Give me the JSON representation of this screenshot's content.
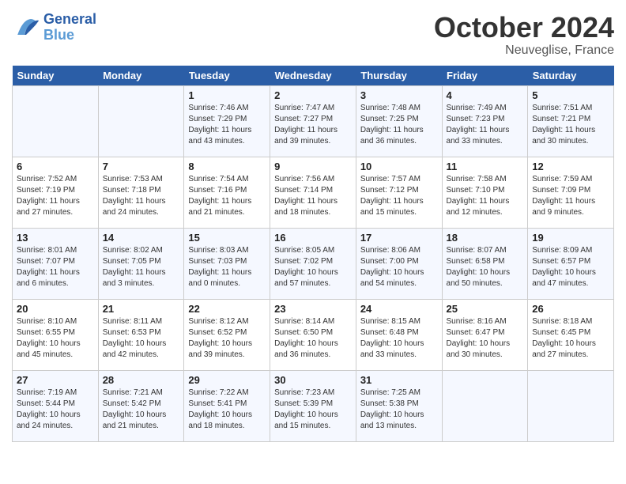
{
  "header": {
    "logo_general": "General",
    "logo_blue": "Blue",
    "month": "October 2024",
    "location": "Neuveglise, France"
  },
  "days_of_week": [
    "Sunday",
    "Monday",
    "Tuesday",
    "Wednesday",
    "Thursday",
    "Friday",
    "Saturday"
  ],
  "weeks": [
    [
      {
        "day": "",
        "info": ""
      },
      {
        "day": "",
        "info": ""
      },
      {
        "day": "1",
        "info": "Sunrise: 7:46 AM\nSunset: 7:29 PM\nDaylight: 11 hours and 43 minutes."
      },
      {
        "day": "2",
        "info": "Sunrise: 7:47 AM\nSunset: 7:27 PM\nDaylight: 11 hours and 39 minutes."
      },
      {
        "day": "3",
        "info": "Sunrise: 7:48 AM\nSunset: 7:25 PM\nDaylight: 11 hours and 36 minutes."
      },
      {
        "day": "4",
        "info": "Sunrise: 7:49 AM\nSunset: 7:23 PM\nDaylight: 11 hours and 33 minutes."
      },
      {
        "day": "5",
        "info": "Sunrise: 7:51 AM\nSunset: 7:21 PM\nDaylight: 11 hours and 30 minutes."
      }
    ],
    [
      {
        "day": "6",
        "info": "Sunrise: 7:52 AM\nSunset: 7:19 PM\nDaylight: 11 hours and 27 minutes."
      },
      {
        "day": "7",
        "info": "Sunrise: 7:53 AM\nSunset: 7:18 PM\nDaylight: 11 hours and 24 minutes."
      },
      {
        "day": "8",
        "info": "Sunrise: 7:54 AM\nSunset: 7:16 PM\nDaylight: 11 hours and 21 minutes."
      },
      {
        "day": "9",
        "info": "Sunrise: 7:56 AM\nSunset: 7:14 PM\nDaylight: 11 hours and 18 minutes."
      },
      {
        "day": "10",
        "info": "Sunrise: 7:57 AM\nSunset: 7:12 PM\nDaylight: 11 hours and 15 minutes."
      },
      {
        "day": "11",
        "info": "Sunrise: 7:58 AM\nSunset: 7:10 PM\nDaylight: 11 hours and 12 minutes."
      },
      {
        "day": "12",
        "info": "Sunrise: 7:59 AM\nSunset: 7:09 PM\nDaylight: 11 hours and 9 minutes."
      }
    ],
    [
      {
        "day": "13",
        "info": "Sunrise: 8:01 AM\nSunset: 7:07 PM\nDaylight: 11 hours and 6 minutes."
      },
      {
        "day": "14",
        "info": "Sunrise: 8:02 AM\nSunset: 7:05 PM\nDaylight: 11 hours and 3 minutes."
      },
      {
        "day": "15",
        "info": "Sunrise: 8:03 AM\nSunset: 7:03 PM\nDaylight: 11 hours and 0 minutes."
      },
      {
        "day": "16",
        "info": "Sunrise: 8:05 AM\nSunset: 7:02 PM\nDaylight: 10 hours and 57 minutes."
      },
      {
        "day": "17",
        "info": "Sunrise: 8:06 AM\nSunset: 7:00 PM\nDaylight: 10 hours and 54 minutes."
      },
      {
        "day": "18",
        "info": "Sunrise: 8:07 AM\nSunset: 6:58 PM\nDaylight: 10 hours and 50 minutes."
      },
      {
        "day": "19",
        "info": "Sunrise: 8:09 AM\nSunset: 6:57 PM\nDaylight: 10 hours and 47 minutes."
      }
    ],
    [
      {
        "day": "20",
        "info": "Sunrise: 8:10 AM\nSunset: 6:55 PM\nDaylight: 10 hours and 45 minutes."
      },
      {
        "day": "21",
        "info": "Sunrise: 8:11 AM\nSunset: 6:53 PM\nDaylight: 10 hours and 42 minutes."
      },
      {
        "day": "22",
        "info": "Sunrise: 8:12 AM\nSunset: 6:52 PM\nDaylight: 10 hours and 39 minutes."
      },
      {
        "day": "23",
        "info": "Sunrise: 8:14 AM\nSunset: 6:50 PM\nDaylight: 10 hours and 36 minutes."
      },
      {
        "day": "24",
        "info": "Sunrise: 8:15 AM\nSunset: 6:48 PM\nDaylight: 10 hours and 33 minutes."
      },
      {
        "day": "25",
        "info": "Sunrise: 8:16 AM\nSunset: 6:47 PM\nDaylight: 10 hours and 30 minutes."
      },
      {
        "day": "26",
        "info": "Sunrise: 8:18 AM\nSunset: 6:45 PM\nDaylight: 10 hours and 27 minutes."
      }
    ],
    [
      {
        "day": "27",
        "info": "Sunrise: 7:19 AM\nSunset: 5:44 PM\nDaylight: 10 hours and 24 minutes."
      },
      {
        "day": "28",
        "info": "Sunrise: 7:21 AM\nSunset: 5:42 PM\nDaylight: 10 hours and 21 minutes."
      },
      {
        "day": "29",
        "info": "Sunrise: 7:22 AM\nSunset: 5:41 PM\nDaylight: 10 hours and 18 minutes."
      },
      {
        "day": "30",
        "info": "Sunrise: 7:23 AM\nSunset: 5:39 PM\nDaylight: 10 hours and 15 minutes."
      },
      {
        "day": "31",
        "info": "Sunrise: 7:25 AM\nSunset: 5:38 PM\nDaylight: 10 hours and 13 minutes."
      },
      {
        "day": "",
        "info": ""
      },
      {
        "day": "",
        "info": ""
      }
    ]
  ]
}
